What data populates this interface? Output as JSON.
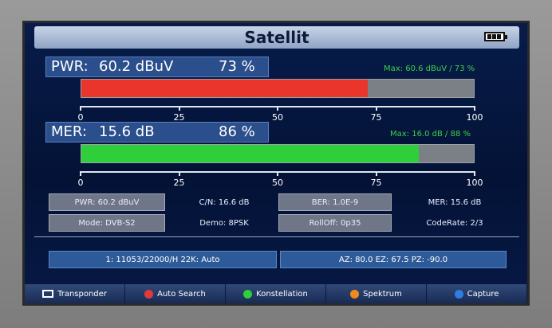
{
  "header": {
    "title": "Satellit",
    "battery_icon": "battery-icon"
  },
  "pwr": {
    "label": "PWR:",
    "value": "60.2 dBuV",
    "percent_text": "73 %",
    "percent": 73,
    "max_text": "Max: 60.6 dBuV / 73 %",
    "bar_color": "#e9352b"
  },
  "mer": {
    "label": "MER:",
    "value": "15.6 dB",
    "percent_text": "86 %",
    "percent": 86,
    "max_text": "Max: 16.0 dB / 88 %",
    "bar_color": "#2ecf3a"
  },
  "axis_ticks": [
    "0",
    "25",
    "50",
    "75",
    "100"
  ],
  "info": {
    "pwr": "PWR: 60.2 dBuV",
    "cn": "C/N: 16.6 dB",
    "ber": "BER: 1.0E-9",
    "mer": "MER: 15.6 dB",
    "mode": "Mode: DVB-S2",
    "demo": "Demo: 8PSK",
    "rolloff": "RollOff: 0p35",
    "coderate": "CodeRate: 2/3"
  },
  "channel": {
    "transponder": "1: 11053/22000/H 22K: Auto",
    "position": "AZ: 80.0  EZ: 67.5  PZ: -90.0"
  },
  "softkeys": [
    {
      "label": "Transponder",
      "icon": "transponder-icon",
      "color": "#ffffff"
    },
    {
      "label": "Auto Search",
      "icon": "red-key-icon",
      "color": "#e23a3a"
    },
    {
      "label": "Konstellation",
      "icon": "green-key-icon",
      "color": "#2ecf3a"
    },
    {
      "label": "Spektrum",
      "icon": "orange-key-icon",
      "color": "#f08a1c"
    },
    {
      "label": "Capture",
      "icon": "blue-key-icon",
      "color": "#2f7de0"
    }
  ]
}
